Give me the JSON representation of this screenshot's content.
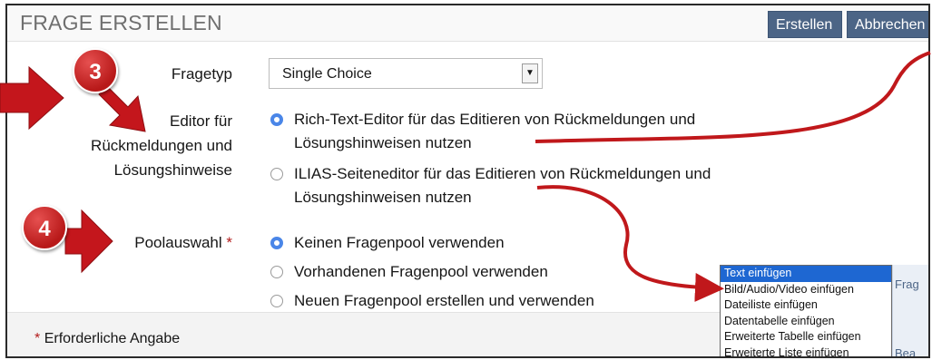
{
  "header": {
    "title": "FRAGE ERSTELLEN",
    "create_label": "Erstellen",
    "cancel_label": "Abbrechen"
  },
  "form": {
    "fragetyp": {
      "label": "Fragetyp",
      "value": "Single Choice"
    },
    "editor": {
      "label_lines": [
        "Editor für",
        "Rückmeldungen und",
        "Lösungshinweise"
      ],
      "options": [
        {
          "lines": [
            "Rich-Text-Editor für das Editieren von Rückmeldungen und",
            "Lösungshinweisen nutzen"
          ],
          "selected": true
        },
        {
          "lines": [
            "ILIAS-Seiteneditor für das Editieren von Rückmeldungen und",
            "Lösungshinweisen nutzen"
          ],
          "selected": false
        }
      ]
    },
    "pool": {
      "label": "Poolauswahl",
      "required_marker": "*",
      "options": [
        {
          "label": "Keinen Fragenpool verwenden",
          "selected": true
        },
        {
          "label": "Vorhandenen Fragenpool verwenden",
          "selected": false
        },
        {
          "label": "Neuen Fragenpool erstellen und verwenden",
          "selected": false
        }
      ]
    }
  },
  "footer": {
    "required_marker": "*",
    "note": "Erforderliche Angabe"
  },
  "dropdown_menu": {
    "items": [
      {
        "label": "Text einfügen",
        "selected": true
      },
      {
        "label": "Bild/Audio/Video einfügen",
        "selected": false
      },
      {
        "label": "Dateiliste einfügen",
        "selected": false
      },
      {
        "label": "Datentabelle einfügen",
        "selected": false
      },
      {
        "label": "Erweiterte Tabelle einfügen",
        "selected": false
      },
      {
        "label": "Erweiterte Liste einfügen",
        "selected": false
      }
    ]
  },
  "side_strip": {
    "text_top": "Frag",
    "text_bottom": "Bea"
  },
  "annotations": {
    "badge_3": "3",
    "badge_4": "4",
    "color": "#c0181b"
  }
}
